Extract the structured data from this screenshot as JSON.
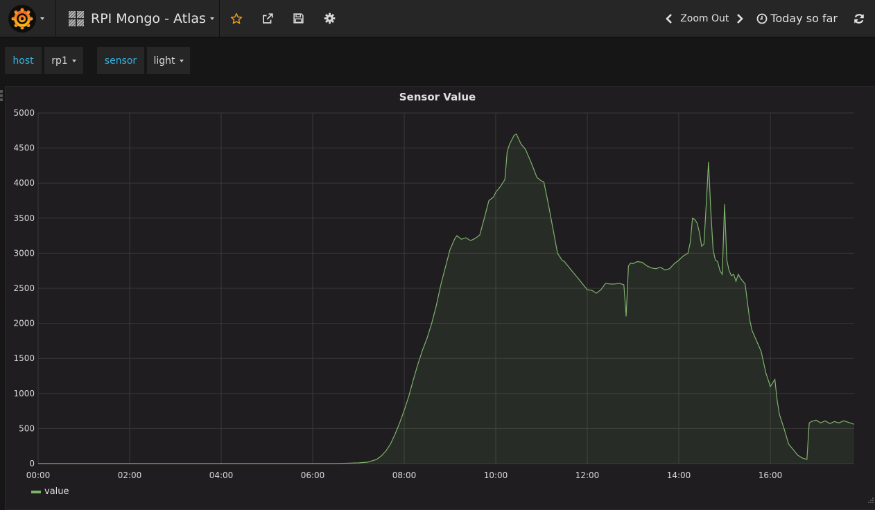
{
  "navbar": {
    "dashboard_title": "RPI Mongo - Atlas",
    "icons": [
      "grafana-logo-icon",
      "star-icon",
      "share-icon",
      "save-icon",
      "gear-icon"
    ],
    "zoom_out_label": "Zoom Out",
    "time_range_label": "Today so far",
    "colors": {
      "star": "#eb9b1e",
      "logo_outer": "#f05a28",
      "logo_inner": "#fbca0a"
    }
  },
  "template_variables": [
    {
      "label": "host",
      "value": "rp1"
    },
    {
      "label": "sensor",
      "value": "light"
    }
  ],
  "panel": {
    "title": "Sensor Value",
    "legend": [
      {
        "name": "value",
        "color": "#7eb26d"
      }
    ]
  },
  "chart_data": {
    "type": "area",
    "title": "Sensor Value",
    "xlabel": "",
    "ylabel": "",
    "x_unit": "hours since 00:00",
    "xlim": [
      0,
      17.83
    ],
    "ylim": [
      0,
      5000
    ],
    "xticks": [
      "00:00",
      "02:00",
      "04:00",
      "06:00",
      "08:00",
      "10:00",
      "12:00",
      "14:00",
      "16:00"
    ],
    "yticks": [
      "0",
      "500",
      "1000",
      "1500",
      "2000",
      "2500",
      "3000",
      "3500",
      "4000",
      "4500",
      "5000"
    ],
    "grid": true,
    "legend_position": "bottom-left",
    "series": [
      {
        "name": "value",
        "color": "#7eb26d",
        "x": [
          0,
          1,
          2,
          3,
          4,
          5,
          6,
          6.5,
          7,
          7.2,
          7.4,
          7.5,
          7.6,
          7.7,
          7.8,
          7.9,
          8.0,
          8.1,
          8.2,
          8.3,
          8.4,
          8.5,
          8.6,
          8.7,
          8.8,
          8.9,
          9.0,
          9.1,
          9.15,
          9.25,
          9.35,
          9.45,
          9.55,
          9.65,
          9.75,
          9.85,
          9.95,
          10.0,
          10.1,
          10.2,
          10.25,
          10.3,
          10.4,
          10.45,
          10.55,
          10.65,
          10.75,
          10.8,
          10.9,
          11.0,
          11.05,
          11.15,
          11.25,
          11.35,
          11.45,
          11.5,
          11.6,
          11.7,
          11.8,
          11.9,
          12.0,
          12.1,
          12.2,
          12.3,
          12.4,
          12.5,
          12.6,
          12.7,
          12.8,
          12.85,
          12.9,
          12.95,
          13.0,
          13.05,
          13.1,
          13.2,
          13.3,
          13.4,
          13.5,
          13.6,
          13.7,
          13.8,
          13.9,
          14.0,
          14.1,
          14.2,
          14.25,
          14.3,
          14.35,
          14.4,
          14.45,
          14.5,
          14.55,
          14.6,
          14.65,
          14.7,
          14.75,
          14.8,
          14.85,
          14.9,
          14.95,
          15.0,
          15.05,
          15.1,
          15.15,
          15.2,
          15.25,
          15.3,
          15.35,
          15.4,
          15.45,
          15.5,
          15.55,
          15.6,
          15.7,
          15.8,
          15.9,
          16.0,
          16.1,
          16.15,
          16.2,
          16.3,
          16.4,
          16.5,
          16.6,
          16.7,
          16.8,
          16.85,
          16.9,
          17.0,
          17.1,
          17.2,
          17.3,
          17.4,
          17.5,
          17.6,
          17.7,
          17.83
        ],
        "values": [
          0,
          0,
          0,
          0,
          0,
          0,
          0,
          0,
          10,
          20,
          60,
          110,
          180,
          280,
          420,
          580,
          760,
          960,
          1200,
          1420,
          1620,
          1790,
          2000,
          2250,
          2550,
          2800,
          3050,
          3200,
          3250,
          3200,
          3220,
          3180,
          3210,
          3260,
          3500,
          3750,
          3800,
          3870,
          3950,
          4050,
          4450,
          4550,
          4680,
          4700,
          4560,
          4480,
          4330,
          4250,
          4080,
          4030,
          4020,
          3700,
          3350,
          3000,
          2900,
          2880,
          2800,
          2720,
          2640,
          2560,
          2480,
          2470,
          2430,
          2480,
          2570,
          2560,
          2560,
          2570,
          2550,
          2100,
          2820,
          2860,
          2850,
          2870,
          2880,
          2870,
          2820,
          2790,
          2780,
          2800,
          2760,
          2780,
          2850,
          2900,
          2960,
          3000,
          3150,
          3500,
          3480,
          3430,
          3300,
          3100,
          3130,
          3700,
          4300,
          3600,
          3050,
          2900,
          2880,
          2750,
          2700,
          3700,
          2900,
          2750,
          2680,
          2700,
          2600,
          2700,
          2640,
          2600,
          2560,
          2300,
          2050,
          1900,
          1750,
          1600,
          1300,
          1100,
          1200,
          900,
          700,
          500,
          280,
          200,
          120,
          80,
          60,
          580,
          600,
          620,
          580,
          610,
          570,
          600,
          580,
          610,
          590,
          560
        ]
      }
    ]
  }
}
